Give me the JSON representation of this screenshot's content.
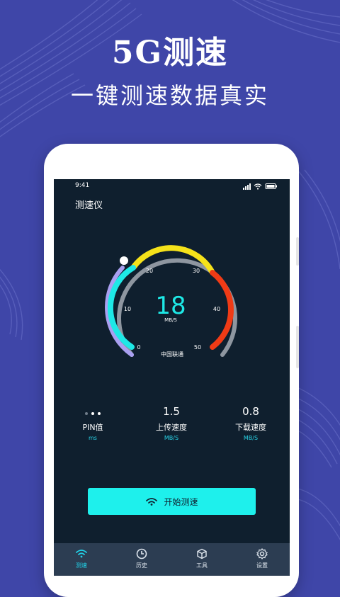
{
  "promo": {
    "title": "5G测速",
    "subtitle": "一键测速数据真实"
  },
  "status_bar": {
    "time": "9:41"
  },
  "app": {
    "title": "测速仪"
  },
  "gauge": {
    "value": "18",
    "unit": "MB/S",
    "carrier": "中国联通",
    "ticks": [
      "0",
      "10",
      "20",
      "30",
      "40",
      "50"
    ],
    "colors": {
      "outer_ring": "#8e96a0",
      "left_arc": "#a99ff0",
      "inner_cyan": "#1ee8e6",
      "yellow": "#f5e21a",
      "red": "#f03b16"
    }
  },
  "stats": {
    "ping": {
      "label": "PIN值",
      "unit": "ms"
    },
    "upload": {
      "value": "1.5",
      "label": "上传速度",
      "unit": "MB/S"
    },
    "download": {
      "value": "0.8",
      "label": "下载速度",
      "unit": "MB/S"
    }
  },
  "start_button": {
    "label": "开始测速",
    "icon": "wifi-icon"
  },
  "tabs": [
    {
      "label": "测速",
      "icon": "wifi-icon",
      "active": true
    },
    {
      "label": "历史",
      "icon": "clock-icon"
    },
    {
      "label": "工具",
      "icon": "box-icon"
    },
    {
      "label": "设置",
      "icon": "gear-icon"
    }
  ],
  "colors": {
    "background": "#3f46a8",
    "screen": "#0f1f2e",
    "accent": "#1ef0ec",
    "tabbar": "#2c3d52"
  }
}
